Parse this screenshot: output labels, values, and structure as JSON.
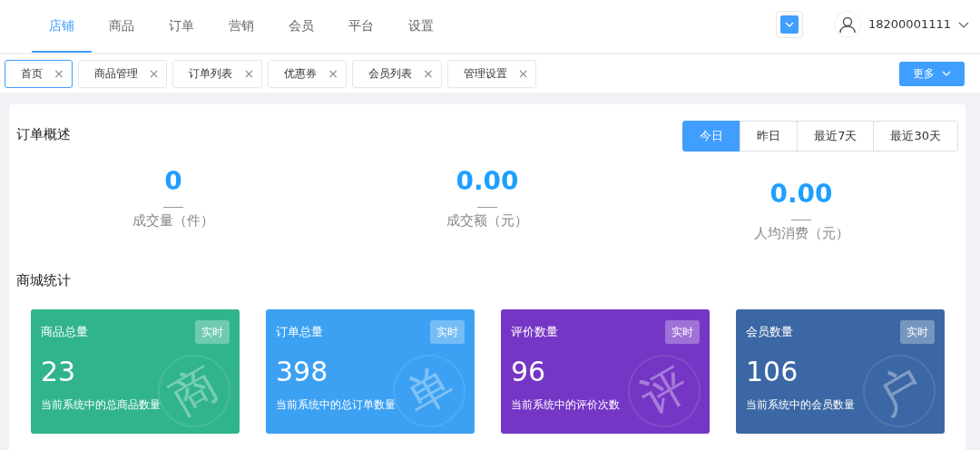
{
  "top_nav": {
    "items": [
      {
        "label": "店铺",
        "selected": true
      },
      {
        "label": "商品",
        "selected": false
      },
      {
        "label": "订单",
        "selected": false
      },
      {
        "label": "营销",
        "selected": false
      },
      {
        "label": "会员",
        "selected": false
      },
      {
        "label": "平台",
        "selected": false
      },
      {
        "label": "设置",
        "selected": false
      }
    ],
    "user": {
      "phone": "18200001111"
    }
  },
  "tabs": {
    "items": [
      {
        "label": "首页",
        "selected": true,
        "close": "×"
      },
      {
        "label": "商品管理",
        "selected": false,
        "close": "×"
      },
      {
        "label": "订单列表",
        "selected": false,
        "close": "×"
      },
      {
        "label": "优惠券",
        "selected": false,
        "close": "×"
      },
      {
        "label": "会员列表",
        "selected": false,
        "close": "×"
      },
      {
        "label": "管理设置",
        "selected": false,
        "close": "×"
      }
    ],
    "more": "更多"
  },
  "order_overview": {
    "title": "订单概述",
    "ranges": [
      {
        "label": "今日",
        "selected": true
      },
      {
        "label": "昨日",
        "selected": false
      },
      {
        "label": "最近7天",
        "selected": false
      },
      {
        "label": "最近30天",
        "selected": false
      }
    ],
    "metrics": [
      {
        "value": "0",
        "label": "成交量（件）"
      },
      {
        "value": "0.00",
        "label": "成交额（元）"
      },
      {
        "value": "0.00",
        "label": "人均消费（元）"
      }
    ]
  },
  "mall_stats": {
    "title": "商城统计",
    "cards": [
      {
        "title": "商品总量",
        "badge": "实时",
        "value": "23",
        "caption": "当前系统中的总商品数量",
        "stamp": "商",
        "color": "#31b48d"
      },
      {
        "title": "订单总量",
        "badge": "实时",
        "value": "398",
        "caption": "当前系统中的总订单数量",
        "stamp": "单",
        "color": "#3ca1f3"
      },
      {
        "title": "评价数量",
        "badge": "实时",
        "value": "96",
        "caption": "当前系统中的评价次数",
        "stamp": "评",
        "color": "#7536c5"
      },
      {
        "title": "会员数量",
        "badge": "实时",
        "value": "106",
        "caption": "当前系统中的会员数量",
        "stamp": "户",
        "color": "#3b67a4"
      }
    ]
  }
}
